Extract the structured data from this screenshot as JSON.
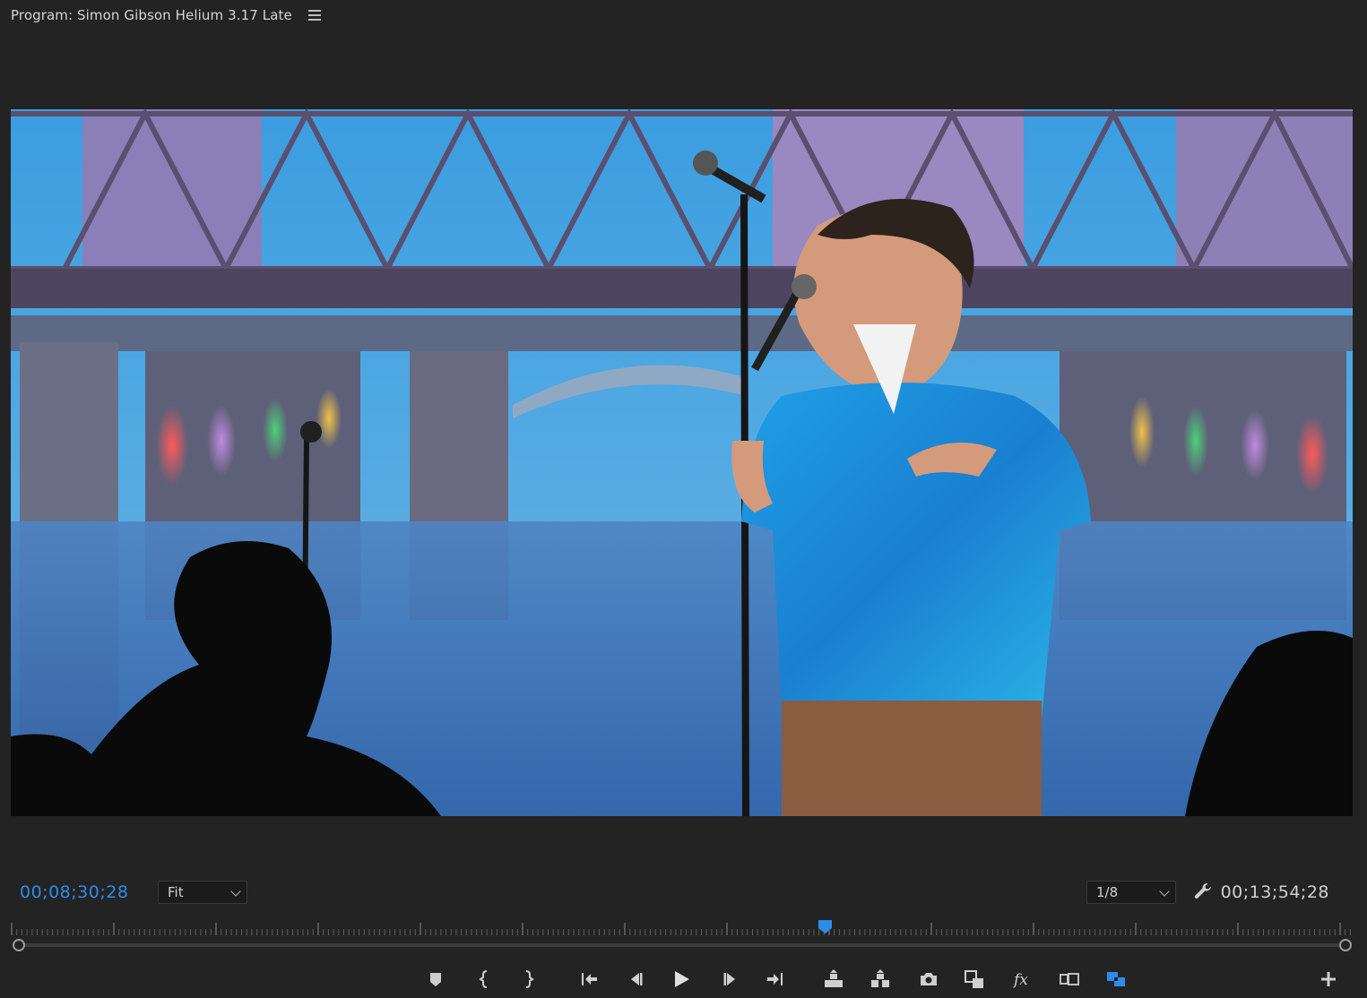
{
  "panel": {
    "title": "Program: Simon Gibson Helium 3.17 Late"
  },
  "timecode": {
    "current": "00;08;30;28",
    "duration": "00;13;54;28"
  },
  "zoom": {
    "selected": "Fit"
  },
  "resolution": {
    "selected": "1/8"
  },
  "playhead": {
    "position_fraction": 0.607
  },
  "colors": {
    "background": "#232323",
    "accent": "#2d8ceb",
    "text": "#c8c8c8"
  },
  "icons": {
    "panel_menu": "hamburger-menu-icon",
    "settings": "wrench-icon",
    "transport": [
      "add-marker-icon",
      "mark-in-icon",
      "mark-out-icon",
      "go-to-in-icon",
      "step-back-icon",
      "play-icon",
      "step-forward-icon",
      "go-to-out-icon",
      "lift-icon",
      "extract-icon",
      "export-frame-icon",
      "insert-icon",
      "effects-fx-icon",
      "comparison-view-icon",
      "proxy-toggle-icon",
      "button-editor-plus-icon"
    ]
  }
}
